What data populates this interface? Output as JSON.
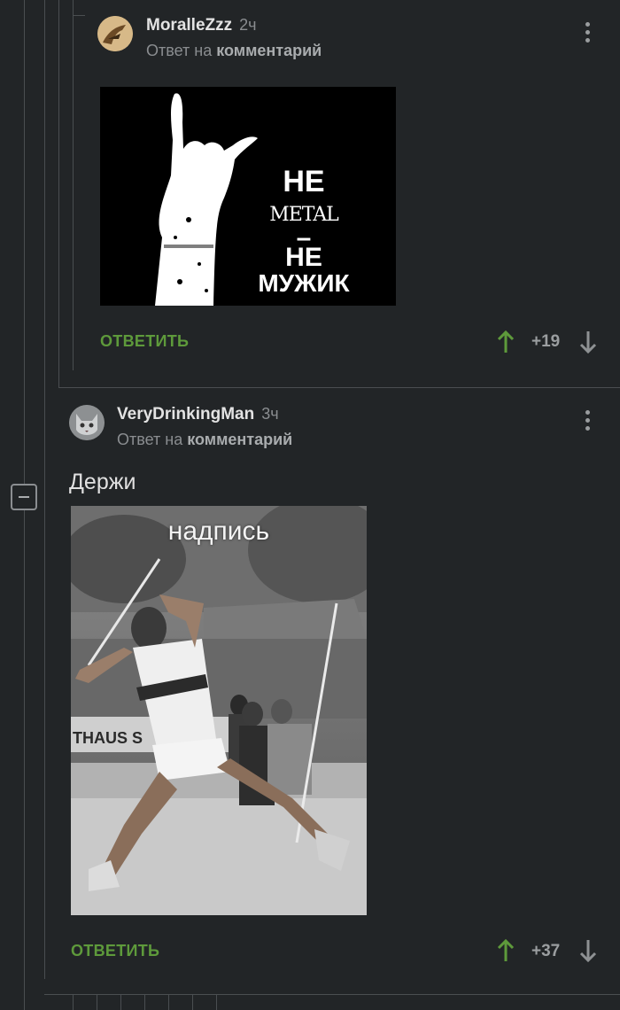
{
  "comments": [
    {
      "username": "MoralleZzz",
      "time": "2ч",
      "reply_prefix": "Ответ на",
      "reply_target": "комментарий",
      "image_text": {
        "line1": "НЕ",
        "line2": "METAL",
        "line3": "–",
        "line4": "НЕ",
        "line5": "МУЖИК"
      },
      "reply_label": "ОТВЕТИТЬ",
      "rating": "+19"
    },
    {
      "username": "VeryDrinkingMan",
      "time": "3ч",
      "reply_prefix": "Ответ на",
      "reply_target": "комментарий",
      "text": "Держи",
      "image_caption": "надпись",
      "image_sign": "THAUS S",
      "reply_label": "ОТВЕТИТЬ",
      "rating": "+37"
    }
  ],
  "colors": {
    "background": "#222527",
    "reply_button": "#5e9a3b",
    "upvote": "#5e9a3b",
    "thread_line": "#4a4e51"
  },
  "icons": [
    "avatar",
    "kebab-menu-icon",
    "arrow-up-icon",
    "arrow-down-icon",
    "collapse-minus-icon"
  ]
}
